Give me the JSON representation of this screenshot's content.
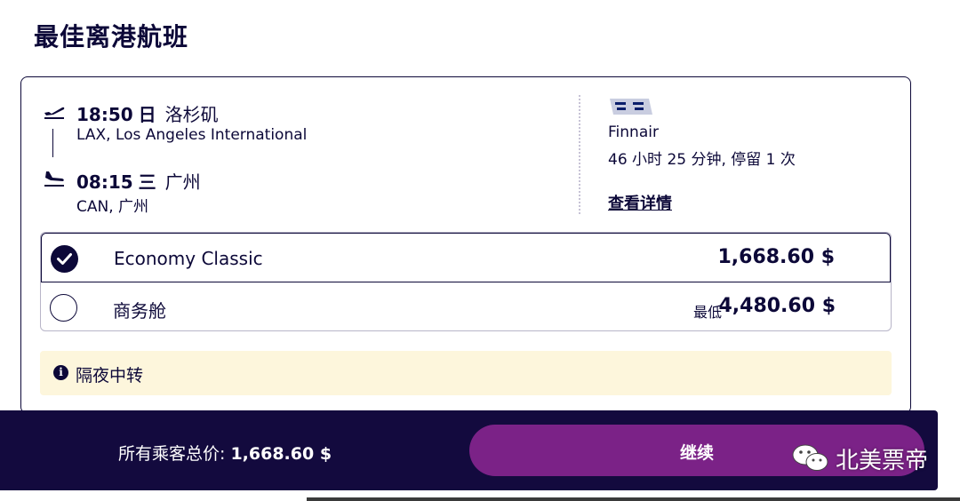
{
  "page": {
    "title": "最佳离港航班"
  },
  "departure": {
    "time": "18:50",
    "day": "日",
    "city": "洛杉矶",
    "airport": "LAX, Los Angeles International",
    "icon": "takeoff-icon"
  },
  "arrival": {
    "time": "08:15",
    "day": "三",
    "city": "广州",
    "airport": "CAN, 广州",
    "icon": "landing-icon"
  },
  "airline": {
    "name": "Finnair",
    "duration": "46 小时 25 分钟, 停留 1 次",
    "details_link": "查看详情"
  },
  "fares": [
    {
      "label": "Economy Classic",
      "prefix": "",
      "price": "1,668.60 $",
      "selected": true
    },
    {
      "label": "商务舱",
      "prefix": "最低",
      "price": "4,480.60 $",
      "selected": false
    }
  ],
  "notice": {
    "icon": "info-icon",
    "text": "隔夜中转"
  },
  "footer": {
    "total_label": "所有乘客总价: ",
    "total_value": "1,668.60 $",
    "continue_label": "继续"
  },
  "watermark": {
    "text": "北美票帝",
    "icon": "wechat-icon"
  },
  "colors": {
    "navy": "#0c0838",
    "footer_bg": "#130a3e",
    "button": "#7b2287",
    "notice_bg": "#fdf6dc"
  }
}
